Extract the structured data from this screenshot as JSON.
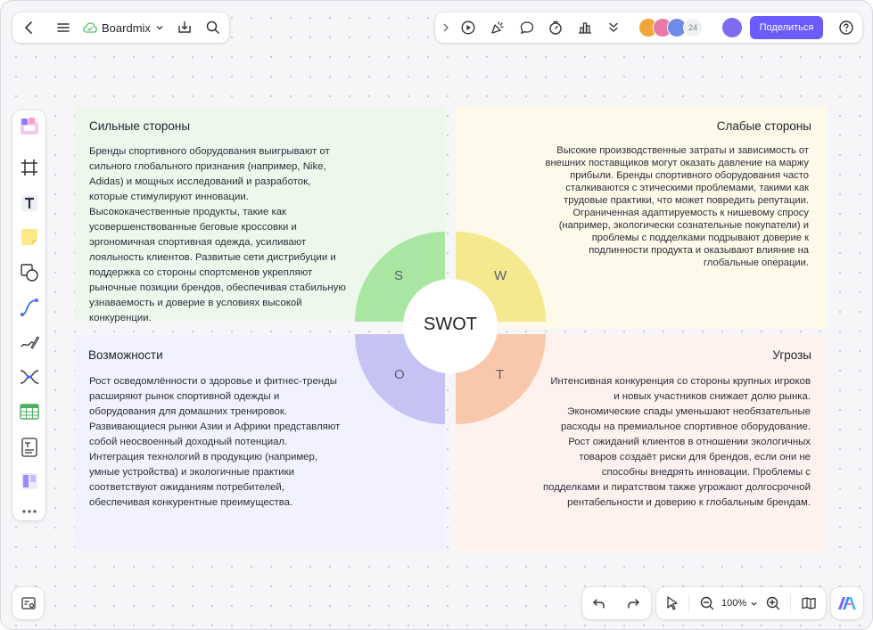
{
  "app": {
    "brand": "Boardmix"
  },
  "topbar": {
    "collaborator_count": "24",
    "share_label": "Поделиться"
  },
  "zoom": {
    "level": "100%"
  },
  "swot": {
    "center_label": "SWOT",
    "letters": {
      "s": "S",
      "w": "W",
      "o": "O",
      "t": "T"
    },
    "colors": {
      "s": "#a8e6a1",
      "w": "#f5e98f",
      "o": "#c5c3f4",
      "t": "#f8c8ab",
      "share": "#6a5cff"
    },
    "strengths": {
      "title": "Сильные стороны",
      "text": "Бренды спортивного оборудования выигрывают от сильного глобального признания (например, Nike, Adidas) и мощных исследований и разработок, которые стимулируют инновации. Высококачественные продукты, такие как усовершенствованные беговые кроссовки и эргономичная спортивная одежда, усиливают лояльность клиентов. Развитые сети дистрибуции и поддержка со стороны спортсменов укрепляют рыночные позиции брендов, обеспечивая стабильную узнаваемость и доверие в условиях высокой конкуренции."
    },
    "weaknesses": {
      "title": "Слабые стороны",
      "text": "Высокие производственные затраты и зависимость от внешних поставщиков могут оказать давление на маржу прибыли. Бренды спортивного оборудования часто сталкиваются с этическими проблемами, такими как трудовые практики, что может повредить репутации. Ограниченная адаптируемость к нишевому спросу (например, экологически сознательные покупатели) и проблемы с подделками подрывают доверие к подлинности продукта и оказывают влияние на глобальные операции."
    },
    "opportunities": {
      "title": "Возможности",
      "text": "Рост осведомлённости о здоровье и фитнес-тренды расширяют рынок спортивной одежды и оборудования для домашних тренировок. Развивающиеся рынки Азии и Африки представляют собой неосвоенный доходный потенциал. Интеграция технологий в продукцию (например, умные устройства) и экологичные практики соответствуют ожиданиям потребителей, обеспечивая конкурентные преимущества."
    },
    "threats": {
      "title": "Угрозы",
      "text": "Интенсивная конкуренция со стороны крупных игроков и новых участников снижает долю рынка. Экономические спады уменьшают необязательные расходы на премиальное спортивное оборудование. Рост ожиданий клиентов в отношении экологичных товаров создаёт риски для брендов, если они не способны внедрять инновации. Проблемы с подделками и пиратством также угрожают долгосрочной рентабельности и доверию к глобальным брендам."
    }
  }
}
